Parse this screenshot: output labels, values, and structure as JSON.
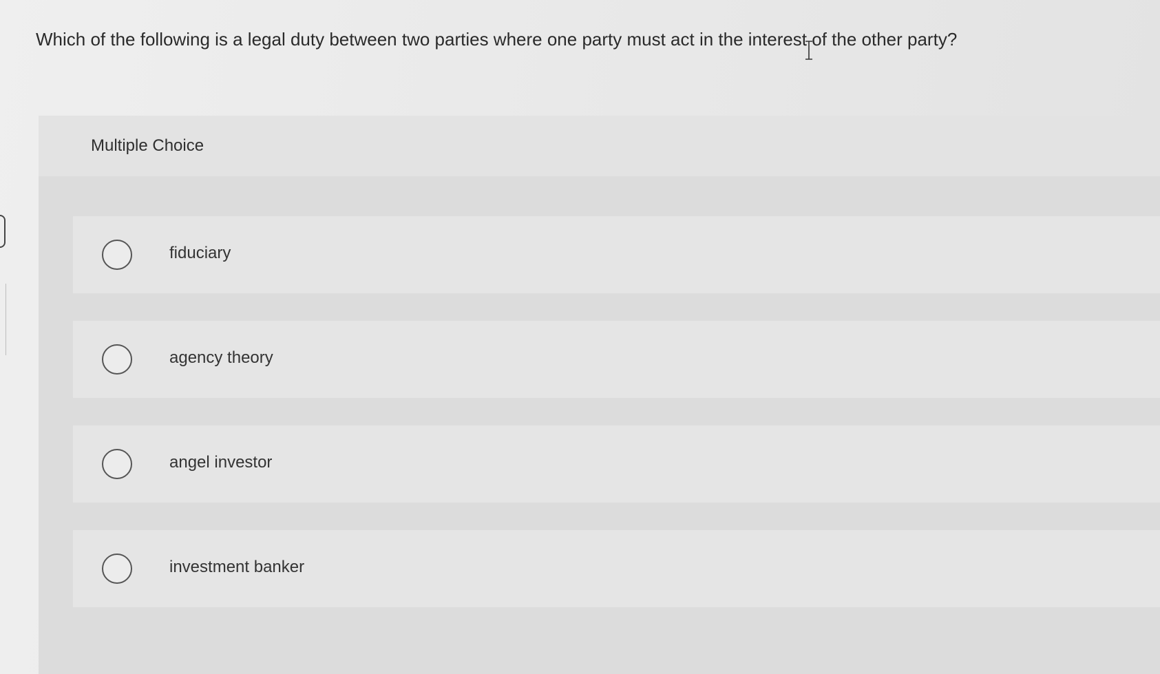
{
  "question": {
    "text": "Which of the following is a legal duty between two parties where one party must act in the interest of the other party?"
  },
  "quiz": {
    "type_label": "Multiple Choice",
    "options": [
      {
        "label": "fiduciary"
      },
      {
        "label": "agency theory"
      },
      {
        "label": "angel investor"
      },
      {
        "label": "investment banker"
      }
    ]
  },
  "colors": {
    "background": "#e9e9e9",
    "panel": "#dcdcdc",
    "option": "#e5e5e5",
    "text": "#2b2b2b"
  }
}
